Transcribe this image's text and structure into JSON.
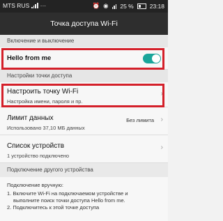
{
  "status_bar": {
    "carrier": "MTS RUS",
    "battery": "25 %",
    "time": "23:18"
  },
  "header": {
    "title": "Точка доступа Wi-Fi"
  },
  "sections": {
    "enable_label": "Включение и выключение",
    "settings_label": "Настройки точки доступа",
    "other_device_label": "Подключение другого устройства"
  },
  "hotspot": {
    "name": "Hello from me",
    "enabled": true
  },
  "settings": {
    "configure_title": "Настроить точку Wi-Fi",
    "configure_subtitle": "Настройка имени, пароля и пр.",
    "limit_title": "Лимит данных",
    "limit_subtitle": "Использовано 37,10 МБ данных",
    "limit_value": "Без лимита",
    "devices_title": "Список устройств",
    "devices_subtitle": "1 устройство подключено"
  },
  "instructions": {
    "line1": "Подключение вручную:",
    "line2": "1. Включите Wi-Fi на подключаемом устройстве и",
    "line3": "выполните поиск точки доступа  Hello from me.",
    "line4": "2. Подключитесь к этой точке доступа"
  }
}
